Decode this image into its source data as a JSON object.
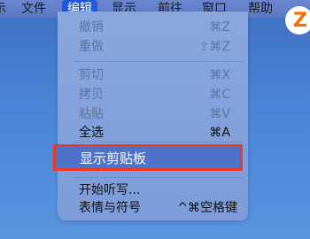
{
  "menubar": {
    "items": [
      {
        "label": "示"
      },
      {
        "label": "文件"
      },
      {
        "label": "编辑"
      },
      {
        "label": "显示"
      },
      {
        "label": "前往"
      },
      {
        "label": "窗口"
      },
      {
        "label": "帮助"
      }
    ],
    "active_index": 2
  },
  "edit_menu": {
    "undo": {
      "label": "撤销",
      "shortcut": "⌘Z"
    },
    "redo": {
      "label": "重做",
      "shortcut": "⇧⌘Z"
    },
    "cut": {
      "label": "剪切",
      "shortcut": "⌘X"
    },
    "copy": {
      "label": "拷贝",
      "shortcut": "⌘C"
    },
    "paste": {
      "label": "粘贴",
      "shortcut": "⌘V"
    },
    "select_all": {
      "label": "全选",
      "shortcut": "⌘A"
    },
    "show_clipboard": {
      "label": "显示剪贴板"
    },
    "start_dictation": {
      "label": "开始听写..."
    },
    "emoji_symbols": {
      "label": "表情与符号",
      "shortcut": "^⌘空格键"
    }
  },
  "badge": {
    "letter": "Z",
    "color": "#ff6a00"
  },
  "colors": {
    "highlight_border": "#e53b2a",
    "active_menu": "#1f5bd8",
    "desktop": "#4b84d6"
  }
}
